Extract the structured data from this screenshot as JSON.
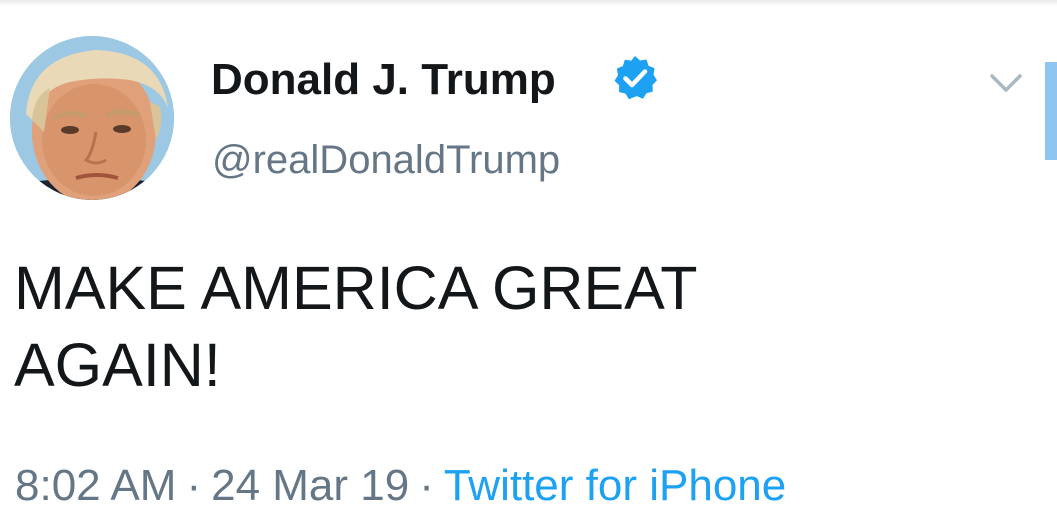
{
  "tweet": {
    "display_name": "Donald J. Trump",
    "handle": "@realDonaldTrump",
    "verified": true,
    "text_line1": "MAKE AMERICA GREAT",
    "text_line2": "AGAIN!",
    "time": "8:02 AM",
    "separator": "·",
    "date": "24 Mar 19",
    "source": "Twitter for iPhone"
  },
  "icons": {
    "verified": "verified-badge-icon",
    "menu": "chevron-down-icon"
  },
  "colors": {
    "text_primary": "#14171a",
    "text_secondary": "#657786",
    "link_blue": "#1da1f2",
    "verified_blue": "#1da1f2"
  }
}
